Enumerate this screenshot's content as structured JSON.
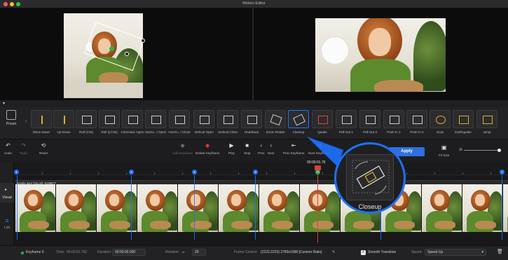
{
  "window": {
    "title": "Motion Editor"
  },
  "strip": {
    "preset_label": "Preset"
  },
  "effects": [
    {
      "label": "Move Down"
    },
    {
      "label": "Up-Down"
    },
    {
      "label": "Roll (CW)"
    },
    {
      "label": "Roll (CCW)"
    },
    {
      "label": "Cinematic Open"
    },
    {
      "label": "Horizo...l Open"
    },
    {
      "label": "Horizo...l Close"
    },
    {
      "label": "Vertical Open"
    },
    {
      "label": "Vertical Close"
    },
    {
      "label": "Heartbeat"
    },
    {
      "label": "Zoom Rotate"
    },
    {
      "label": "Closeup"
    },
    {
      "label": "Quake"
    },
    {
      "label": "Pull Out 1"
    },
    {
      "label": "Pull Out 2"
    },
    {
      "label": "Push In 1"
    },
    {
      "label": "Push In 2"
    },
    {
      "label": "Scan"
    },
    {
      "label": "Earthquake"
    },
    {
      "label": "Jump"
    }
  ],
  "toolbar": {
    "undo": "Undo",
    "redo": "Redo",
    "reset": "Reset",
    "add_keyframe": "Add Keyframe",
    "delete_keyframe": "Delete Keyframe",
    "play": "Play",
    "stop": "Stop",
    "prev": "Prev",
    "next": "Next",
    "prev_keyframe": "Prev Keyframe",
    "next_keyframe": "Next Keyframe",
    "apply": "Apply",
    "fit_size": "Fit Size"
  },
  "timeline": {
    "track_label": "Visual",
    "list_label": "List",
    "clip_name": "people pare foto.girl--9199877",
    "playhead_time": "00:00:01.76",
    "keyframes": [
      "1",
      "2",
      "3",
      "4",
      "5",
      "6",
      "7"
    ]
  },
  "magnifier": {
    "label": "Closeup"
  },
  "bottom": {
    "keyframe_label": "Keyframe 5",
    "time_label": "Time:",
    "time_value": "00:00:01.760",
    "duration_label": "Duration:",
    "duration_value": "00:00:00.000",
    "rotation_label": "Rotation:",
    "rotation_value": "20",
    "frame_control_label": "Frame Control:",
    "frame_control_value": "{2222,2223}  2789x1588  [Custom Ratio]",
    "smooth_label": "Smooth Transition",
    "speed_label": "Speed:",
    "speed_value": "Speed Up"
  },
  "colors": {
    "accent": "#1d72ff",
    "apply": "#2f6fe0",
    "playhead": "#e23b3b",
    "active_keyframe": "#1db954"
  }
}
